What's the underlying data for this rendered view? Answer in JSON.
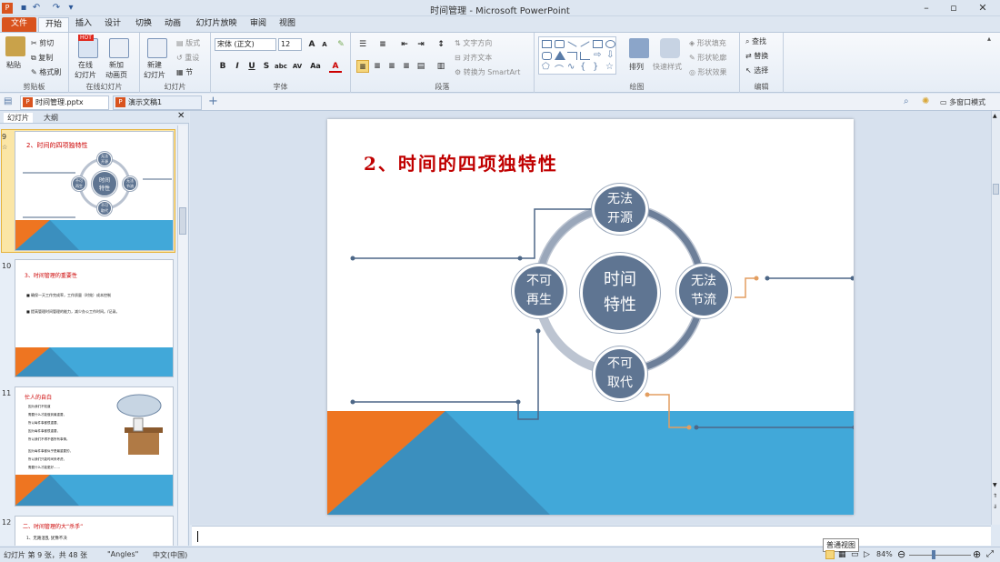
{
  "window": {
    "title": "时间管理 - Microsoft PowerPoint"
  },
  "ribbon_tabs": [
    "文件",
    "开始",
    "插入",
    "设计",
    "切换",
    "动画",
    "幻灯片放映",
    "审阅",
    "视图"
  ],
  "ribbon": {
    "clipboard": {
      "label": "剪贴板",
      "paste": "粘贴",
      "cut": "剪切",
      "copy": "复制",
      "format_painter": "格式刷"
    },
    "online": {
      "label": "在线幻灯片",
      "online_slide": "在线\n幻灯片",
      "add_anim": "新加\n动画页",
      "hot": "HOT"
    },
    "slides": {
      "label": "幻灯片",
      "new_slide": "新建\n幻灯片",
      "layout": "版式",
      "reset": "重设",
      "section": "节"
    },
    "font": {
      "label": "字体",
      "font_name": "宋体 (正文)",
      "font_size": "12"
    },
    "paragraph": {
      "label": "段落",
      "text_direction": "文字方向",
      "align_text": "对齐文本",
      "smartart": "转换为 SmartArt"
    },
    "drawing": {
      "label": "绘图",
      "arrange": "排列",
      "quick_styles": "快速样式",
      "shape_fill": "形状填充",
      "shape_outline": "形状轮廓",
      "shape_effects": "形状效果"
    },
    "editing": {
      "label": "编辑",
      "find": "查找",
      "replace": "替换",
      "select": "选择"
    }
  },
  "doc_tabs": [
    "时间管理.pptx",
    "演示文稿1"
  ],
  "multi_window": "多窗口模式",
  "panel_tabs": [
    "幻灯片",
    "大纲"
  ],
  "thumbnails": [
    {
      "num": "9",
      "title": "2、时间的四项独特性",
      "center": "时间\n特性",
      "top": "无法\n开源",
      "left": "不可\n再生",
      "right": "无法\n节流",
      "bottom": "不可\n取代"
    },
    {
      "num": "10",
      "title": "3、时间管理的重要性",
      "lines": [
        "■ 确保一天工作完成率，工作质量（时效）成本控制",
        "■ 提高管理时间管理的能力，减少办公工作时间。/记录。"
      ]
    },
    {
      "num": "11",
      "title": "忙人的自白",
      "lines": [
        "因为我们不知道",
        "需要什么才能做到最重要，",
        "所以每件事都很重要、",
        "因为每件事都很重要，",
        "所以我们不得不做所有事情。",
        "",
        "因为每件事都似乎是最重要的，",
        "所以我们只能时间来考虑，",
        "需要什么才能更好……"
      ]
    },
    {
      "num": "12",
      "title": "二、时间管理的大“杀手”",
      "lines": [
        "1、无路混乱  犹豫不决"
      ]
    }
  ],
  "slide": {
    "title": "2、时间的四项独特性",
    "center": "时间\n特性",
    "top": "无法\n开源",
    "left": "不可\n再生",
    "right": "无法\n节流",
    "bottom": "不可\n取代"
  },
  "tooltip": "普通视图",
  "status": {
    "slide_info": "幻灯片 第 9 张，共 48 张",
    "theme": "\"Angles\"",
    "lang": "中文(中国)",
    "zoom": "84%"
  },
  "colors": {
    "orange": "#ee7521",
    "blue": "#41a8d9",
    "circle": "#5f7592",
    "ring": "#b9c2d0",
    "title": "#cc0000"
  }
}
